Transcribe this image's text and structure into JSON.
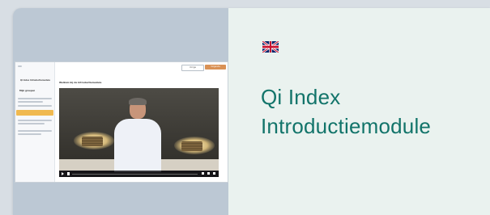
{
  "card": {
    "language_flag": "uk-flag-icon",
    "title_line1": "Qi Index",
    "title_line2": "Introductiemodule"
  },
  "thumbnail": {
    "sidebar": {
      "course_title": "Qi Index Introductiemodule",
      "section": "Mijn groepen",
      "selected_item_icon": "orange-highlight"
    },
    "topbar": {
      "prev_label": "Vorige",
      "next_label": "Volgende"
    },
    "lesson_title": "Welkom bij de Introductiemodule",
    "video": {
      "progress": 0.0
    }
  },
  "colors": {
    "page_bg": "#d8dee4",
    "media_panel": "#bcc8d4",
    "info_panel": "#eaf2ef",
    "title": "#12746a",
    "accent_orange": "#d99155"
  }
}
